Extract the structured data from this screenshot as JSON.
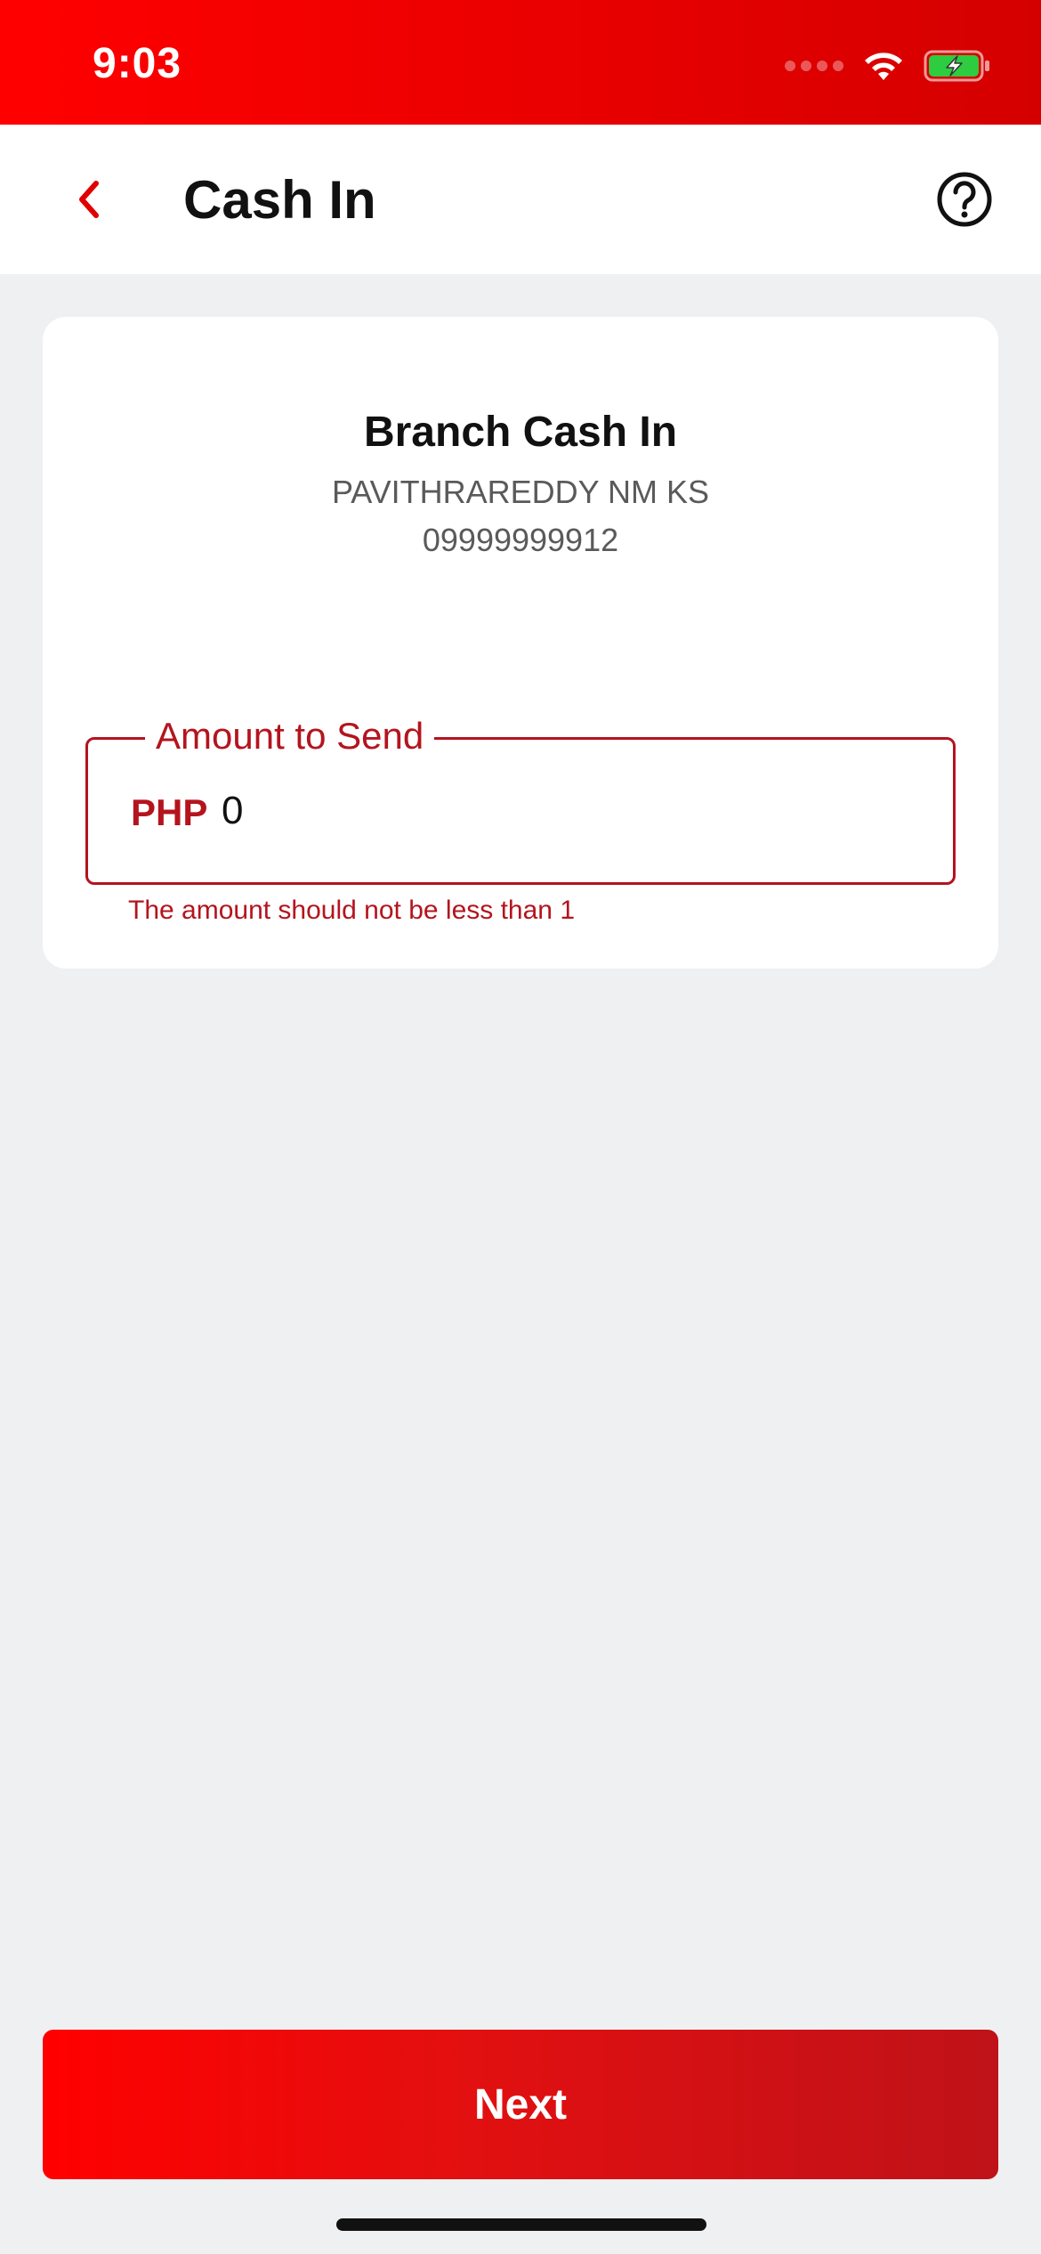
{
  "status_bar": {
    "time": "9:03",
    "icons": [
      "signal-icon",
      "wifi-icon",
      "battery-charging-icon"
    ],
    "battery_color": "#2ecc40"
  },
  "header": {
    "title": "Cash In",
    "back_icon": "chevron-left-icon",
    "help_icon": "help-circle-icon"
  },
  "card": {
    "title": "Branch Cash In",
    "name": "PAVITHRAREDDY NM KS",
    "phone": "09999999912"
  },
  "amount_field": {
    "label": "Amount to Send",
    "currency": "PHP",
    "value": "0",
    "error": "The amount should not be less than 1"
  },
  "footer": {
    "next_label": "Next"
  },
  "colors": {
    "brand_red": "#ff0000",
    "error_red": "#b4141e",
    "background": "#eff0f2"
  }
}
